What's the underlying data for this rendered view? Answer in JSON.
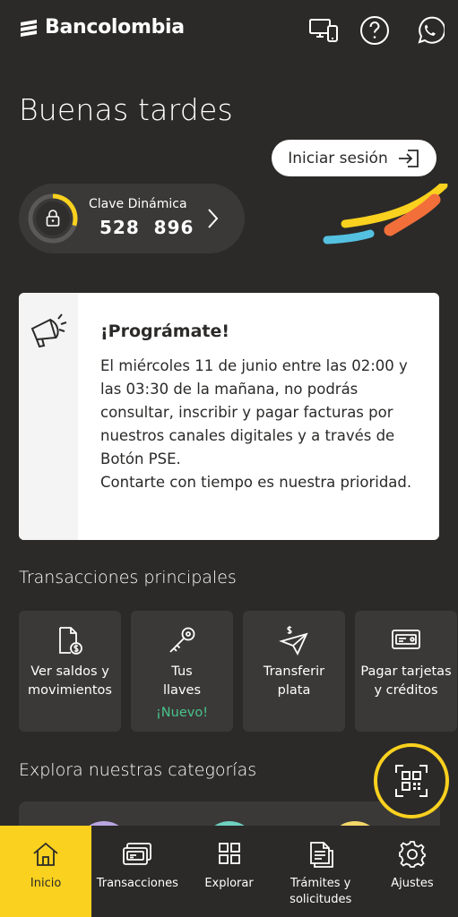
{
  "header": {
    "brand": "Bancolombia",
    "icons": [
      "devices-icon",
      "help-icon",
      "whatsapp-icon"
    ]
  },
  "greeting": "Buenas tardes",
  "login_button": "Iniciar sesión",
  "clave": {
    "title": "Clave Dinámica",
    "code": "528  896",
    "timer_progress": 0.3
  },
  "notice": {
    "title": "¡Prográmate!",
    "body": "El miércoles 11 de junio entre las 02:00 y las 03:30 de la mañana, no podrás consultar, inscribir y pagar facturas por nuestros canales digitales y a través de Botón PSE.\nContarte con tiempo es nuestra prioridad."
  },
  "transactions": {
    "title": "Transacciones principales",
    "items": [
      {
        "label": "Ver saldos y\nmovimientos",
        "badge": "",
        "icon": "balance-document-icon"
      },
      {
        "label": "Tus\nllaves",
        "badge": "¡Nuevo!",
        "icon": "key-icon"
      },
      {
        "label": "Transferir\nplata",
        "badge": "",
        "icon": "transfer-plane-icon"
      },
      {
        "label": "Pagar tarjetas\ny créditos",
        "badge": "",
        "icon": "card-icon"
      }
    ]
  },
  "categories": {
    "title": "Explora nuestras categorías"
  },
  "bottom_nav": [
    {
      "label": "Inicio",
      "icon": "home-icon",
      "active": true
    },
    {
      "label": "Transacciones",
      "icon": "transactions-icon",
      "active": false
    },
    {
      "label": "Explorar",
      "icon": "grid-icon",
      "active": false
    },
    {
      "label": "Trámites y\nsolicitudes",
      "icon": "documents-icon",
      "active": false
    },
    {
      "label": "Ajustes",
      "icon": "gear-icon",
      "active": false
    }
  ],
  "colors": {
    "background": "#2b2a29",
    "accent_yellow": "#f9d11e",
    "accent_orange": "#f26f3a",
    "accent_blue": "#54c1e0",
    "badge_green": "#4ac38a"
  }
}
